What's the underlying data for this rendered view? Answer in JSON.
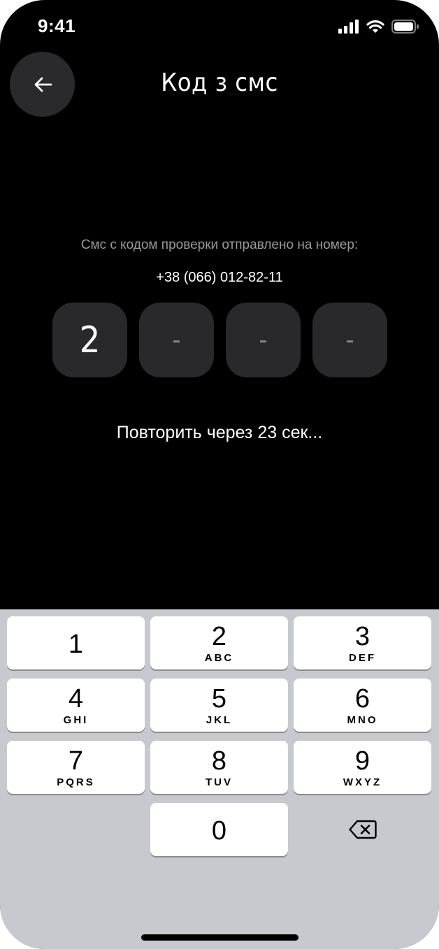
{
  "status_bar": {
    "time": "9:41",
    "signal_icon": "signal-bars-icon",
    "wifi_icon": "wifi-icon",
    "battery_icon": "battery-icon"
  },
  "header": {
    "title": "Код з смс",
    "back_icon": "arrow-left-icon"
  },
  "verify": {
    "message": "Смс с кодом проверки отправлено на номер:",
    "phone": "+38 (066) 012-82-11",
    "code": [
      "2",
      "-",
      "-",
      "-"
    ],
    "resend": "Повторить через 23 сек..."
  },
  "keyboard": {
    "keys": [
      {
        "num": "1",
        "letters": ""
      },
      {
        "num": "2",
        "letters": "ABC"
      },
      {
        "num": "3",
        "letters": "DEF"
      },
      {
        "num": "4",
        "letters": "GHI"
      },
      {
        "num": "5",
        "letters": "JKL"
      },
      {
        "num": "6",
        "letters": "MNO"
      },
      {
        "num": "7",
        "letters": "PQRS"
      },
      {
        "num": "8",
        "letters": "TUV"
      },
      {
        "num": "9",
        "letters": "WXYZ"
      },
      {
        "num": "0",
        "letters": ""
      }
    ],
    "backspace_icon": "backspace-icon"
  },
  "colors": {
    "background": "#000000",
    "code_box": "#29292b",
    "keyboard_bg": "#c7c9ce",
    "key_bg": "#ffffff"
  }
}
